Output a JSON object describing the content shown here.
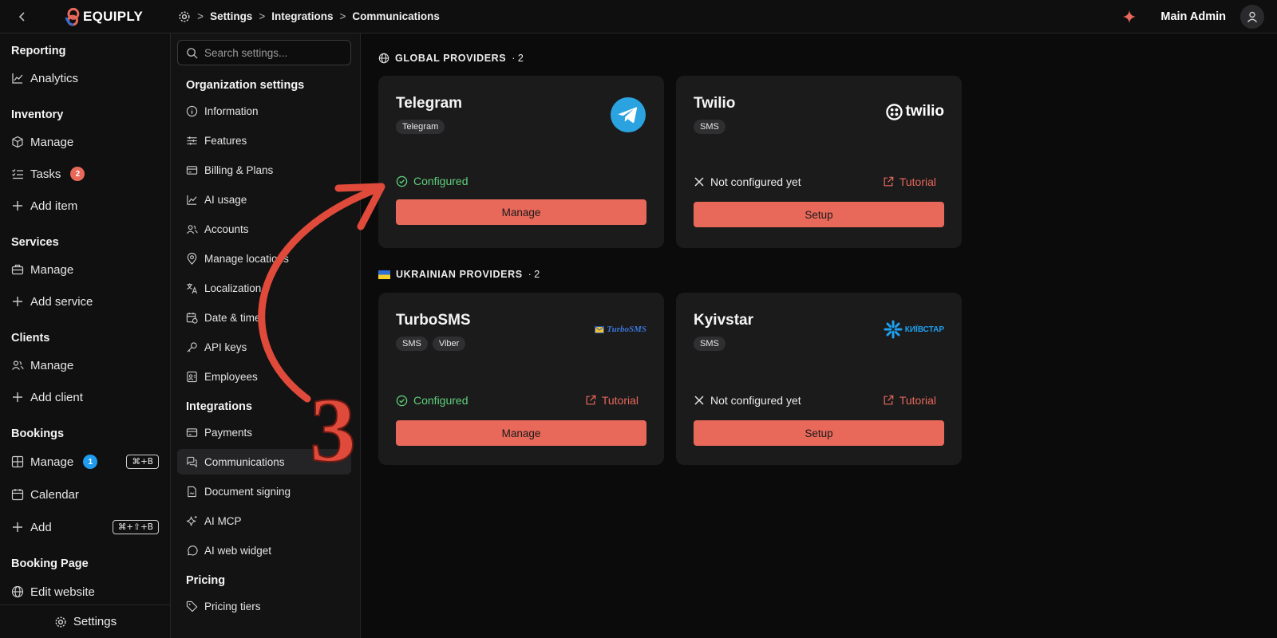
{
  "topbar": {
    "back_icon": "chevron-left-icon",
    "logo_text": "EQUIPLY",
    "breadcrumbs": [
      "Settings",
      "Integrations",
      "Communications"
    ],
    "user_name": "Main Admin"
  },
  "leftnav": {
    "sections": [
      {
        "title": "Reporting",
        "items": [
          {
            "label": "Analytics",
            "icon": "chart-line-icon"
          }
        ]
      },
      {
        "title": "Inventory",
        "items": [
          {
            "label": "Manage",
            "icon": "box-icon"
          },
          {
            "label": "Tasks",
            "icon": "list-check-icon",
            "badge": "2"
          },
          {
            "label": "Add item",
            "icon": "plus-icon"
          }
        ]
      },
      {
        "title": "Services",
        "items": [
          {
            "label": "Manage",
            "icon": "briefcase-icon"
          },
          {
            "label": "Add service",
            "icon": "plus-icon"
          }
        ]
      },
      {
        "title": "Clients",
        "items": [
          {
            "label": "Manage",
            "icon": "users-icon"
          },
          {
            "label": "Add client",
            "icon": "plus-icon"
          }
        ]
      },
      {
        "title": "Bookings",
        "items": [
          {
            "label": "Manage",
            "icon": "grid-icon",
            "badge": "1",
            "shortcut": "⌘+B"
          },
          {
            "label": "Calendar",
            "icon": "calendar-icon"
          },
          {
            "label": "Add",
            "icon": "plus-icon",
            "shortcut": "⌘+⇧+B"
          }
        ]
      },
      {
        "title": "Booking Page",
        "items": [
          {
            "label": "Edit website",
            "icon": "globe-icon"
          }
        ]
      }
    ],
    "bottom_label": "Settings"
  },
  "settingsnav": {
    "search_placeholder": "Search settings...",
    "org_title": "Organization settings",
    "org_items": [
      "Information",
      "Features",
      "Billing & Plans",
      "AI usage",
      "Accounts",
      "Manage locations",
      "Localization",
      "Date & time",
      "API keys",
      "Employees"
    ],
    "integrations_title": "Integrations",
    "integration_items": [
      "Payments",
      "Communications",
      "Document signing",
      "AI MCP",
      "AI web widget"
    ],
    "active_item": "Communications",
    "pricing_title": "Pricing",
    "pricing_items": [
      "Pricing tiers"
    ]
  },
  "main": {
    "global_group": {
      "title": "GLOBAL PROVIDERS",
      "count": "· 2"
    },
    "ukrainian_group": {
      "title": "UKRAINIAN PROVIDERS",
      "count": "· 2"
    },
    "providers": {
      "telegram": {
        "name": "Telegram",
        "tags": [
          "Telegram"
        ],
        "status": "Configured",
        "button": "Manage"
      },
      "twilio": {
        "name": "Twilio",
        "tags": [
          "SMS"
        ],
        "status": "Not configured yet",
        "tutorial": "Tutorial",
        "button": "Setup",
        "logo_text": "twilio"
      },
      "turbosms": {
        "name": "TurboSMS",
        "tags": [
          "SMS",
          "Viber"
        ],
        "status": "Configured",
        "tutorial": "Tutorial",
        "button": "Manage",
        "logo_text": "TurboSMS"
      },
      "kyivstar": {
        "name": "Kyivstar",
        "tags": [
          "SMS"
        ],
        "status": "Not configured yet",
        "tutorial": "Tutorial",
        "button": "Setup",
        "logo_text": "КИЇВСТАР"
      }
    }
  },
  "annotation": {
    "step_number": "3"
  },
  "colors": {
    "accent": "#e8685a",
    "success": "#5fd07a",
    "badge_blue": "#1f9cf0",
    "card_bg": "#1b1b1c"
  }
}
